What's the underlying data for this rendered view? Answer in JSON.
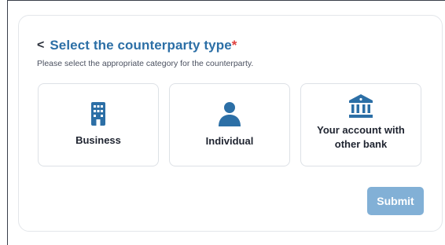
{
  "header": {
    "back_glyph": "<",
    "title": "Select the counterparty type",
    "required_marker": "*"
  },
  "subtitle": "Please select the appropriate category for the counterparty.",
  "options": [
    {
      "label": "Business",
      "icon": "building-icon"
    },
    {
      "label": "Individual",
      "icon": "person-icon"
    },
    {
      "label": "Your account with other bank",
      "icon": "bank-icon"
    }
  ],
  "submit_label": "Submit",
  "colors": {
    "accent": "#2c6fa6",
    "required": "#e0423f",
    "submit_disabled": "#82b0d6"
  }
}
